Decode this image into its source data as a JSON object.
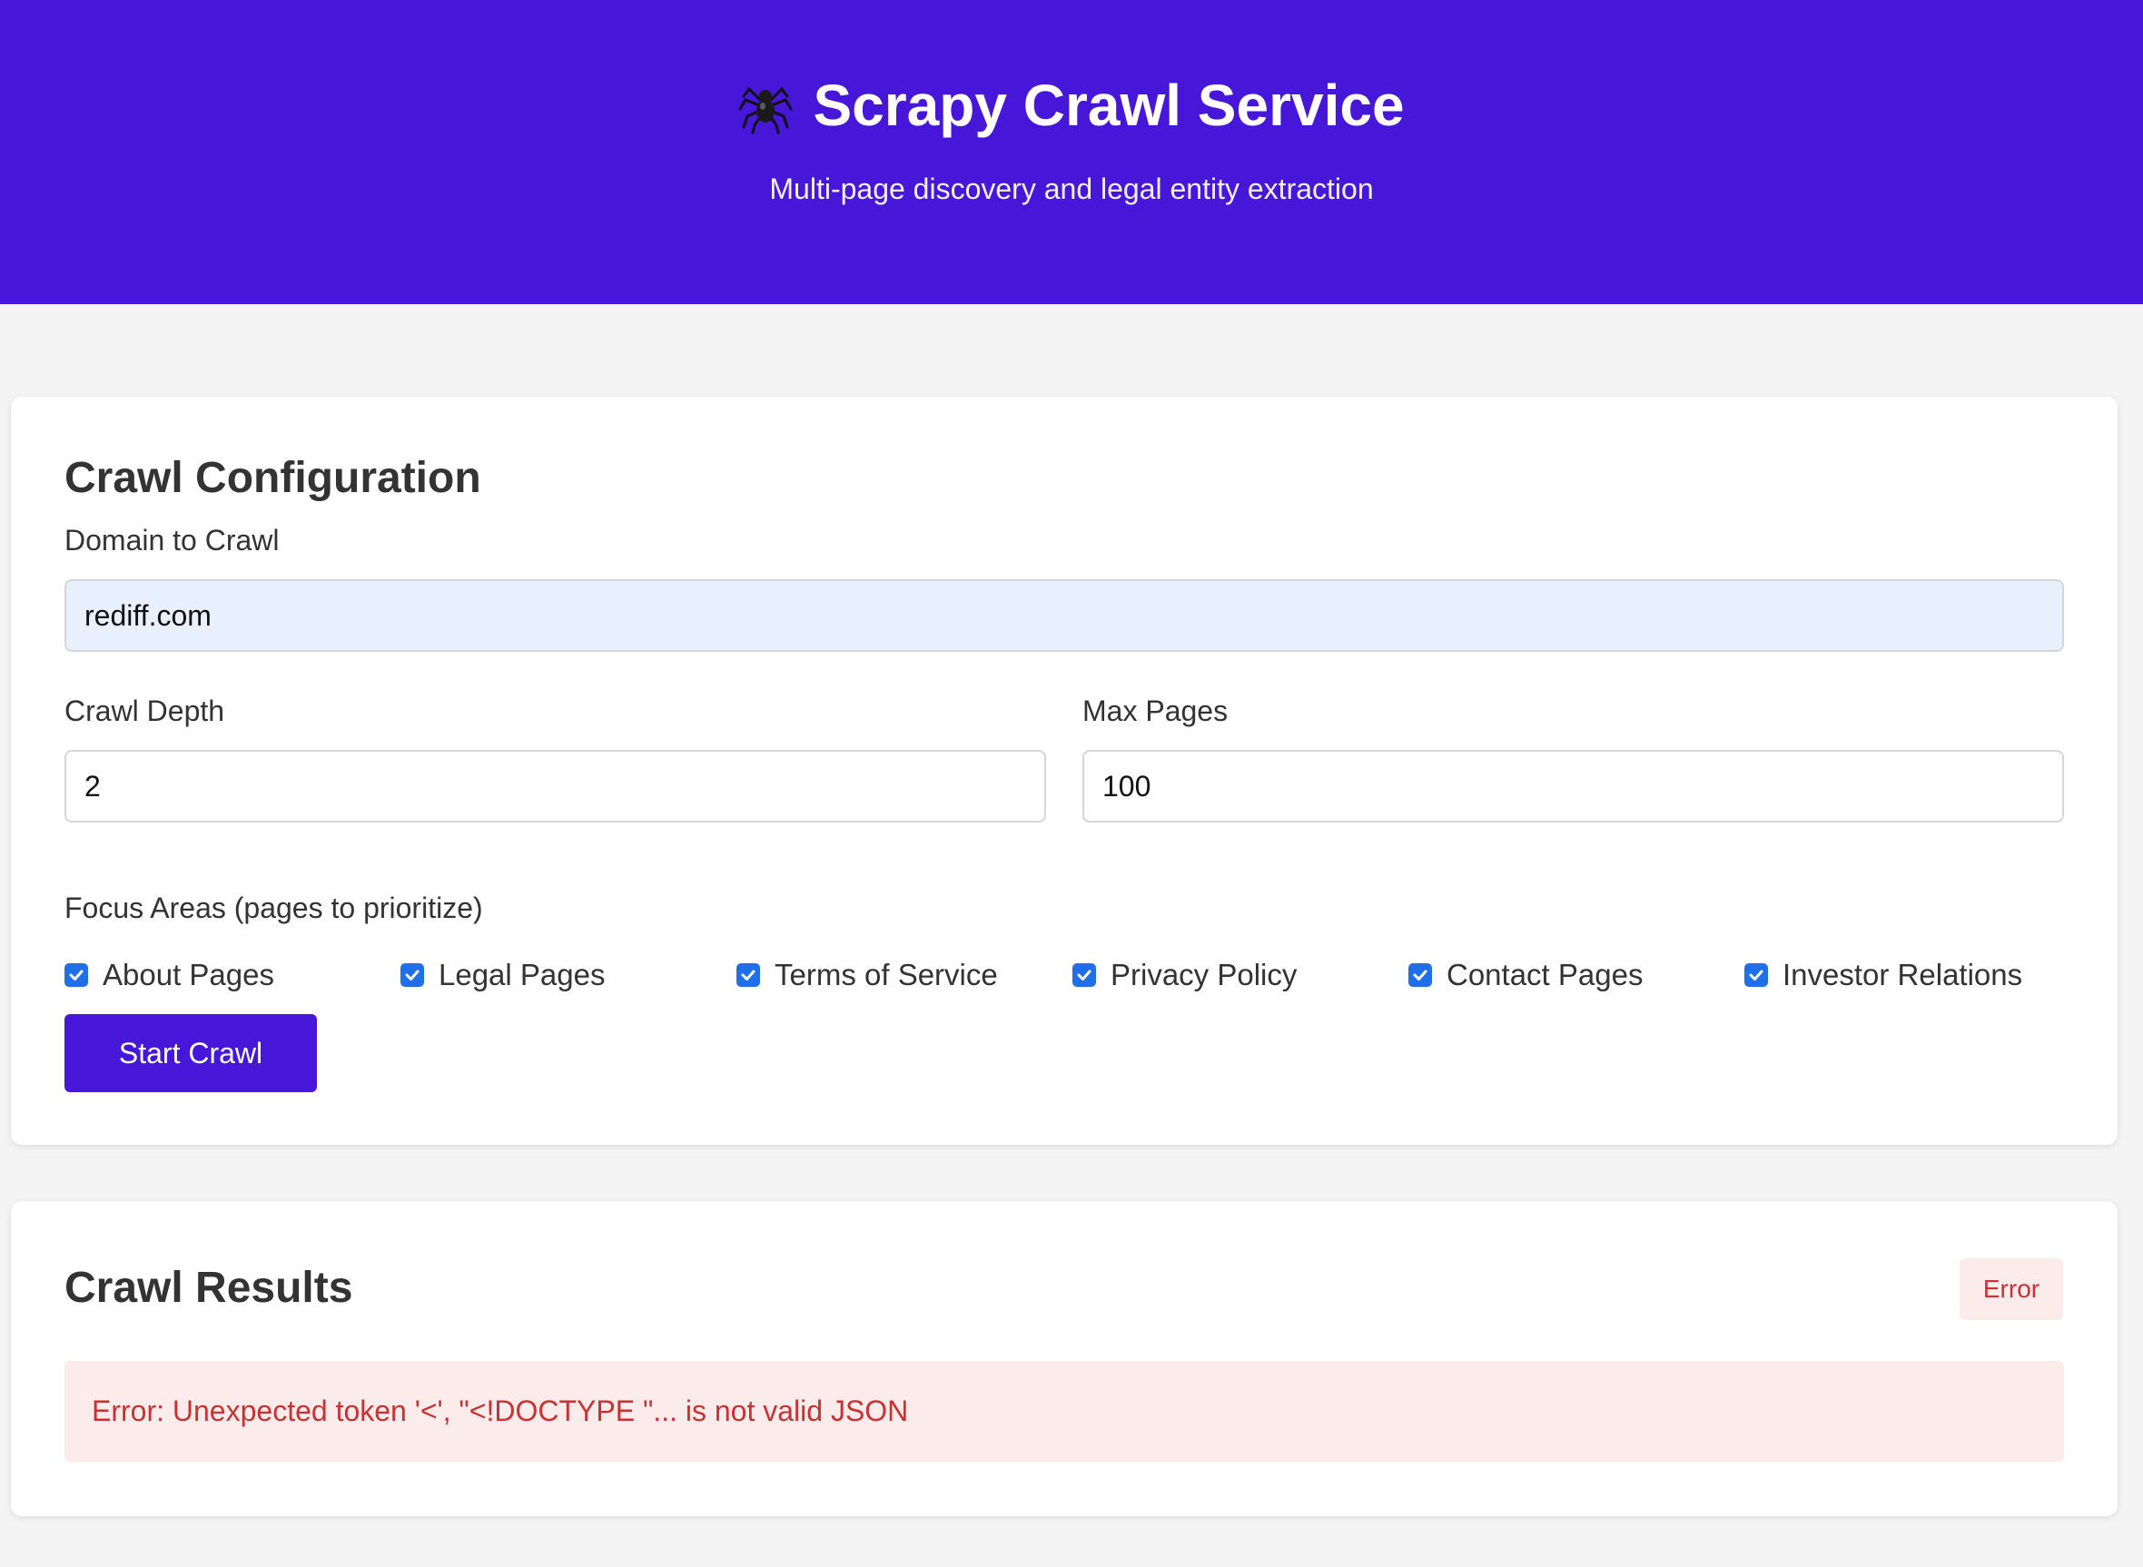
{
  "header": {
    "title": "Scrapy Crawl Service",
    "title_icon": "spider-icon",
    "subtitle": "Multi-page discovery and legal entity extraction",
    "background": "#4617d9"
  },
  "config": {
    "title": "Crawl Configuration",
    "domain_label": "Domain to Crawl",
    "domain_value": "rediff.com",
    "depth_label": "Crawl Depth",
    "depth_value": "2",
    "max_pages_label": "Max Pages",
    "max_pages_value": "100",
    "focus_label": "Focus Areas (pages to prioritize)",
    "focus_areas": [
      {
        "label": "About Pages",
        "checked": true
      },
      {
        "label": "Legal Pages",
        "checked": true
      },
      {
        "label": "Terms of Service",
        "checked": true
      },
      {
        "label": "Privacy Policy",
        "checked": true
      },
      {
        "label": "Contact Pages",
        "checked": true
      },
      {
        "label": "Investor Relations",
        "checked": true
      }
    ],
    "start_button": "Start Crawl"
  },
  "results": {
    "title": "Crawl Results",
    "status": "Error",
    "error_message": "Error: Unexpected token '<', \"<!DOCTYPE \"... is not valid JSON"
  },
  "colors": {
    "accent": "#4617d9",
    "checkbox": "#1f6fe8",
    "error_text": "#c83232",
    "error_bg": "#fcebeb"
  }
}
